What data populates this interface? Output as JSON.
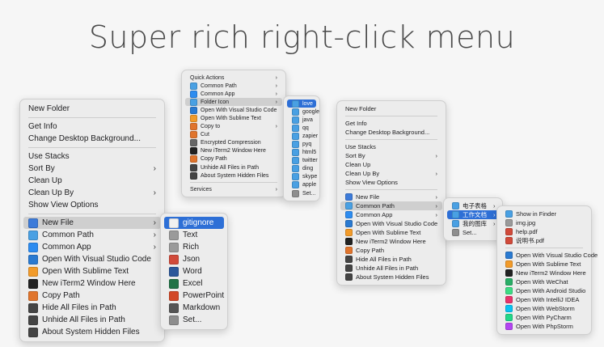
{
  "title": "Super rich right-click menu",
  "menu1": {
    "items": [
      {
        "label": "New Folder"
      },
      {
        "sep": true
      },
      {
        "label": "Get Info"
      },
      {
        "label": "Change Desktop Background..."
      },
      {
        "sep": true
      },
      {
        "label": "Use Stacks"
      },
      {
        "label": "Sort By",
        "submenu": true
      },
      {
        "label": "Clean Up"
      },
      {
        "label": "Clean Up By",
        "submenu": true
      },
      {
        "label": "Show View Options"
      },
      {
        "sep": true
      },
      {
        "label": "New File",
        "icon": "file-icon",
        "color": "#3d7bd9",
        "submenu": true,
        "highlight": "gray"
      },
      {
        "label": "Common Path",
        "icon": "folder-icon",
        "color": "#49a0e3",
        "submenu": true
      },
      {
        "label": "Common App",
        "icon": "app-store-icon",
        "color": "#2d8cf0",
        "submenu": true
      },
      {
        "label": "Open With Visual Studio Code",
        "icon": "vscode-icon",
        "color": "#2a7ad1"
      },
      {
        "label": "Open With Sublime Text",
        "icon": "sublime-icon",
        "color": "#f29b2a"
      },
      {
        "label": "New iTerm2 Window Here",
        "icon": "terminal-icon",
        "color": "#222222"
      },
      {
        "label": "Copy Path",
        "icon": "copy-path-icon",
        "color": "#e0742c"
      },
      {
        "label": "Hide All Files in Path",
        "icon": "eye-closed-icon",
        "color": "#444444"
      },
      {
        "label": "Unhide All Files in Path",
        "icon": "eye-icon",
        "color": "#444444"
      },
      {
        "label": "About System Hidden Files",
        "icon": "info-icon",
        "color": "#444444"
      }
    ],
    "submenu": [
      {
        "label": "gitignore",
        "icon": "git-icon",
        "color": "#f1f1f1",
        "highlight": "blue"
      },
      {
        "label": "Text",
        "icon": "text-icon",
        "color": "#9a9a9a"
      },
      {
        "label": "Rich",
        "icon": "rich-text-icon",
        "color": "#9a9a9a"
      },
      {
        "label": "Json",
        "icon": "json-icon",
        "color": "#d14a3a"
      },
      {
        "label": "Word",
        "icon": "word-icon",
        "color": "#2b579a"
      },
      {
        "label": "Excel",
        "icon": "excel-icon",
        "color": "#217346"
      },
      {
        "label": "PowerPoint",
        "icon": "powerpoint-icon",
        "color": "#d24726"
      },
      {
        "label": "Markdown",
        "icon": "markdown-icon",
        "color": "#555555"
      },
      {
        "label": "Set...",
        "icon": "gear-icon",
        "color": "#8e8e8e"
      }
    ]
  },
  "menu2": {
    "items": [
      {
        "label": "Quick Actions",
        "submenu": true
      },
      {
        "label": "Common Path",
        "icon": "folder-icon",
        "color": "#49a0e3",
        "submenu": true
      },
      {
        "label": "Common App",
        "icon": "app-store-icon",
        "color": "#2d8cf0",
        "submenu": true
      },
      {
        "label": "Folder Icon",
        "icon": "folder-image-icon",
        "color": "#49a0e3",
        "submenu": true,
        "highlight": "gray"
      },
      {
        "label": "Open With Visual Studio Code",
        "icon": "vscode-icon",
        "color": "#2a7ad1"
      },
      {
        "label": "Open With Sublime Text",
        "icon": "sublime-icon",
        "color": "#f29b2a"
      },
      {
        "label": "Copy to",
        "icon": "copy-to-icon",
        "color": "#e0742c",
        "submenu": true
      },
      {
        "label": "Cut",
        "icon": "scissors-icon",
        "color": "#e0742c"
      },
      {
        "label": "Encrypted Compression",
        "icon": "lock-icon",
        "color": "#666666"
      },
      {
        "label": "New iTerm2 Window Here",
        "icon": "terminal-icon",
        "color": "#222222"
      },
      {
        "label": "Copy Path",
        "icon": "copy-path-icon",
        "color": "#e0742c"
      },
      {
        "label": "Unhide All Files in Path",
        "icon": "eye-icon",
        "color": "#444444"
      },
      {
        "label": "About System Hidden Files",
        "icon": "info-icon",
        "color": "#444444"
      },
      {
        "sep": true
      },
      {
        "label": "Services",
        "submenu": true
      }
    ],
    "submenu": [
      {
        "label": "love",
        "icon": "folder-icon",
        "color": "#49a0e3",
        "highlight": "blue"
      },
      {
        "label": "google",
        "icon": "folder-icon",
        "color": "#49a0e3"
      },
      {
        "label": "java",
        "icon": "folder-icon",
        "color": "#49a0e3"
      },
      {
        "label": "qq",
        "icon": "folder-icon",
        "color": "#49a0e3"
      },
      {
        "label": "zapier",
        "icon": "folder-icon",
        "color": "#49a0e3"
      },
      {
        "label": "pyq",
        "icon": "folder-icon",
        "color": "#49a0e3"
      },
      {
        "label": "html5",
        "icon": "folder-icon",
        "color": "#49a0e3"
      },
      {
        "label": "twitter",
        "icon": "folder-icon",
        "color": "#49a0e3"
      },
      {
        "label": "ding",
        "icon": "folder-icon",
        "color": "#49a0e3"
      },
      {
        "label": "skype",
        "icon": "folder-icon",
        "color": "#49a0e3"
      },
      {
        "label": "apple",
        "icon": "folder-icon",
        "color": "#49a0e3"
      },
      {
        "label": "Set...",
        "icon": "gear-icon",
        "color": "#8e8e8e"
      }
    ]
  },
  "menu3": {
    "items": [
      {
        "label": "New Folder"
      },
      {
        "sep": true
      },
      {
        "label": "Get Info"
      },
      {
        "label": "Change Desktop Background..."
      },
      {
        "sep": true
      },
      {
        "label": "Use Stacks"
      },
      {
        "label": "Sort By",
        "submenu": true
      },
      {
        "label": "Clean Up"
      },
      {
        "label": "Clean Up By",
        "submenu": true
      },
      {
        "label": "Show View Options"
      },
      {
        "sep": true
      },
      {
        "label": "New File",
        "icon": "file-icon",
        "color": "#3d7bd9",
        "submenu": true
      },
      {
        "label": "Common Path",
        "icon": "folder-icon",
        "color": "#49a0e3",
        "submenu": true,
        "highlight": "gray"
      },
      {
        "label": "Common App",
        "icon": "app-store-icon",
        "color": "#2d8cf0",
        "submenu": true
      },
      {
        "label": "Open With Visual Studio Code",
        "icon": "vscode-icon",
        "color": "#2a7ad1"
      },
      {
        "label": "Open With Sublime Text",
        "icon": "sublime-icon",
        "color": "#f29b2a"
      },
      {
        "label": "New iTerm2 Window Here",
        "icon": "terminal-icon",
        "color": "#222222"
      },
      {
        "label": "Copy Path",
        "icon": "copy-path-icon",
        "color": "#e0742c"
      },
      {
        "label": "Hide All Files in Path",
        "icon": "eye-closed-icon",
        "color": "#444444"
      },
      {
        "label": "Unhide All Files in Path",
        "icon": "eye-icon",
        "color": "#444444"
      },
      {
        "label": "About System Hidden Files",
        "icon": "info-icon",
        "color": "#444444"
      }
    ],
    "submenu": [
      {
        "label": "电子表格",
        "icon": "folder-icon",
        "color": "#49a0e3",
        "submenu": true
      },
      {
        "label": "工作文档",
        "icon": "folder-icon",
        "color": "#49a0e3",
        "submenu": true,
        "highlight": "blue"
      },
      {
        "label": "我的图库",
        "icon": "folder-icon",
        "color": "#49a0e3",
        "submenu": true
      },
      {
        "label": "Set...",
        "icon": "gear-icon",
        "color": "#8e8e8e"
      }
    ],
    "submenu2": [
      {
        "label": "Show in Finder",
        "icon": "finder-icon",
        "color": "#49a0e3"
      },
      {
        "label": "img.jpg",
        "icon": "image-file-icon",
        "color": "#9a9a9a"
      },
      {
        "label": "help.pdf",
        "icon": "pdf-icon",
        "color": "#d14a3a"
      },
      {
        "label": "说明书.pdf",
        "icon": "pdf-icon",
        "color": "#d14a3a"
      },
      {
        "sep": true
      },
      {
        "label": "Open With Visual Studio Code",
        "icon": "vscode-icon",
        "color": "#2a7ad1"
      },
      {
        "label": "Open With Sublime Text",
        "icon": "sublime-icon",
        "color": "#f29b2a"
      },
      {
        "label": "New iTerm2 Window Here",
        "icon": "terminal-icon",
        "color": "#222222"
      },
      {
        "label": "Open With WeChat",
        "icon": "wechat-icon",
        "color": "#2aae67"
      },
      {
        "label": "Open With Android Studio",
        "icon": "android-studio-icon",
        "color": "#3ddc84"
      },
      {
        "label": "Open With IntelliJ IDEA",
        "icon": "intellij-icon",
        "color": "#e8336b"
      },
      {
        "label": "Open With WebStorm",
        "icon": "webstorm-icon",
        "color": "#07c3f2"
      },
      {
        "label": "Open With PyCharm",
        "icon": "pycharm-icon",
        "color": "#21d789"
      },
      {
        "label": "Open With PhpStorm",
        "icon": "phpstorm-icon",
        "color": "#b345f1"
      }
    ]
  }
}
